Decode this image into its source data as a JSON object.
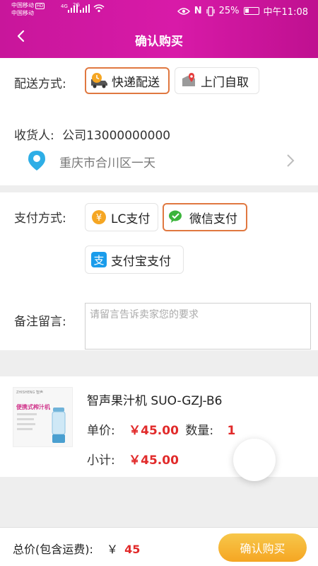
{
  "status_bar": {
    "carrier_1": "中国移动",
    "carrier_1_badge": "HD",
    "carrier_2": "中国移动",
    "signal_1_label": "4G",
    "signal_2_label": "2G",
    "battery": "25%",
    "time": "中午11:08"
  },
  "header": {
    "title": "确认购买"
  },
  "delivery": {
    "label": "配送方式:",
    "options": [
      {
        "label": "快递配送",
        "icon": "delivery-truck-icon",
        "selected": true
      },
      {
        "label": "上门自取",
        "icon": "pickup-location-icon",
        "selected": false
      }
    ]
  },
  "receiver": {
    "label": "收货人:",
    "name_phone": "公司13000000000",
    "address": "重庆市合川区一天"
  },
  "payment": {
    "label": "支付方式:",
    "options": [
      {
        "label": "LC支付",
        "icon": "yen-coin-icon",
        "selected": false
      },
      {
        "label": "微信支付",
        "icon": "wechat-icon",
        "selected": true
      },
      {
        "label": "支付宝支付",
        "icon": "alipay-icon",
        "selected": false
      }
    ]
  },
  "remark": {
    "label": "备注留言:",
    "placeholder": "请留言告诉卖家您的要求",
    "value": ""
  },
  "product": {
    "name": "智声果汁机 SUO-GZJ-B6",
    "image_text": "便携式榨汁机",
    "image_brand": "ZHISHENG 智声",
    "unit_price_label": "单价:",
    "unit_price": "￥45.00",
    "quantity_label": "数量:",
    "quantity": "1",
    "subtotal_label": "小计:",
    "subtotal": "￥45.00"
  },
  "footer": {
    "total_label": "总价(包含运费):",
    "currency": "￥",
    "total": "45",
    "confirm_label": "确认购买"
  },
  "colors": {
    "header_magenta": "#d81aa8",
    "selected_border": "#e07840",
    "price_red": "#e12a2a",
    "button_orange": "#f5a623"
  }
}
